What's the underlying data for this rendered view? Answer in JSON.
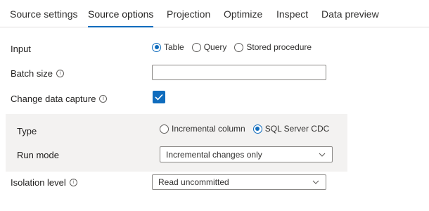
{
  "tabs": [
    "Source settings",
    "Source options",
    "Projection",
    "Optimize",
    "Inspect",
    "Data preview"
  ],
  "active_tab": "Source options",
  "input": {
    "label": "Input",
    "options": [
      "Table",
      "Query",
      "Stored procedure"
    ],
    "selected": "Table"
  },
  "batch_size": {
    "label": "Batch size",
    "value": ""
  },
  "change_data_capture": {
    "label": "Change data capture",
    "checked": true
  },
  "cdc_panel": {
    "type": {
      "label": "Type",
      "options": [
        "Incremental column",
        "SQL Server CDC"
      ],
      "selected": "SQL Server CDC"
    },
    "run_mode": {
      "label": "Run mode",
      "value": "Incremental changes only"
    }
  },
  "isolation_level": {
    "label": "Isolation level",
    "value": "Read uncommitted"
  },
  "icons": {
    "info": "info-icon",
    "chevron": "chevron-down-icon",
    "check": "checkmark-icon"
  },
  "colors": {
    "accent": "#0f6cbd",
    "panel_bg": "#f3f2f1",
    "border": "#8a8886"
  }
}
